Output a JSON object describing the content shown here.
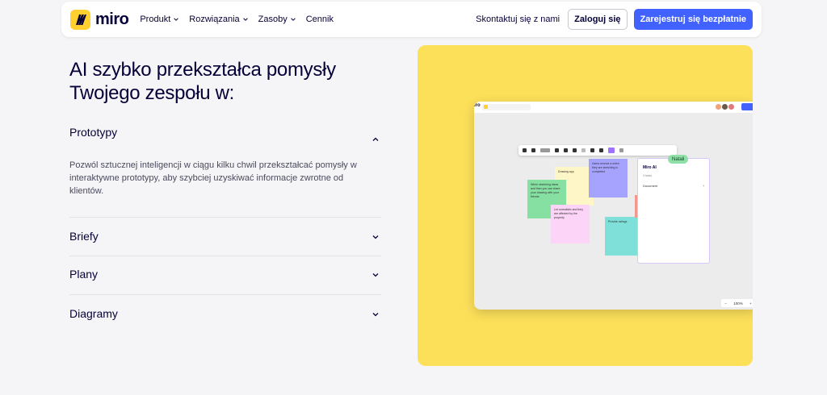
{
  "header": {
    "logo_text": "miro",
    "nav": [
      {
        "label": "Produkt",
        "dropdown": true
      },
      {
        "label": "Rozwiązania",
        "dropdown": true
      },
      {
        "label": "Zasoby",
        "dropdown": true
      },
      {
        "label": "Cennik",
        "dropdown": false
      }
    ],
    "contact": "Skontaktuj się z nami",
    "login": "Zaloguj się",
    "signup": "Zarejestruj się bezpłatnie"
  },
  "main": {
    "headline": "AI szybko przekształca pomysły Twojego zespołu w:",
    "accordion": [
      {
        "title": "Prototypy",
        "expanded": true,
        "description": "Pozwól sztucznej inteligencji w ciągu kilku chwil przekształcać pomysły w interaktywne prototypy, aby szybciej uzyskiwać informacje zwrotne od klientów."
      },
      {
        "title": "Briefy",
        "expanded": false
      },
      {
        "title": "Plany",
        "expanded": false
      },
      {
        "title": "Diagramy",
        "expanded": false
      }
    ]
  },
  "preview": {
    "board_logo": "iro",
    "sticky_cream": "Drawing app",
    "sticky_purple": "Users receive a when they are sketching is completed",
    "sticky_green": "When sketching ideas and then you can share your drawing with your friends",
    "sticky_pink": "Let unrealistic and they are affected by the property",
    "sticky_teal": "Provide ratings",
    "ai_title": "Miro AI",
    "ai_sub": "3 tasks",
    "ai_row": "Document",
    "cursor_name": "Natali",
    "zoom_minus": "−",
    "zoom_level": "100%",
    "zoom_plus": "+"
  },
  "colors": {
    "brand_yellow": "#FFD02F",
    "panel_yellow": "#FCE05A",
    "primary_blue": "#4262FF",
    "text_dark": "#050038"
  }
}
